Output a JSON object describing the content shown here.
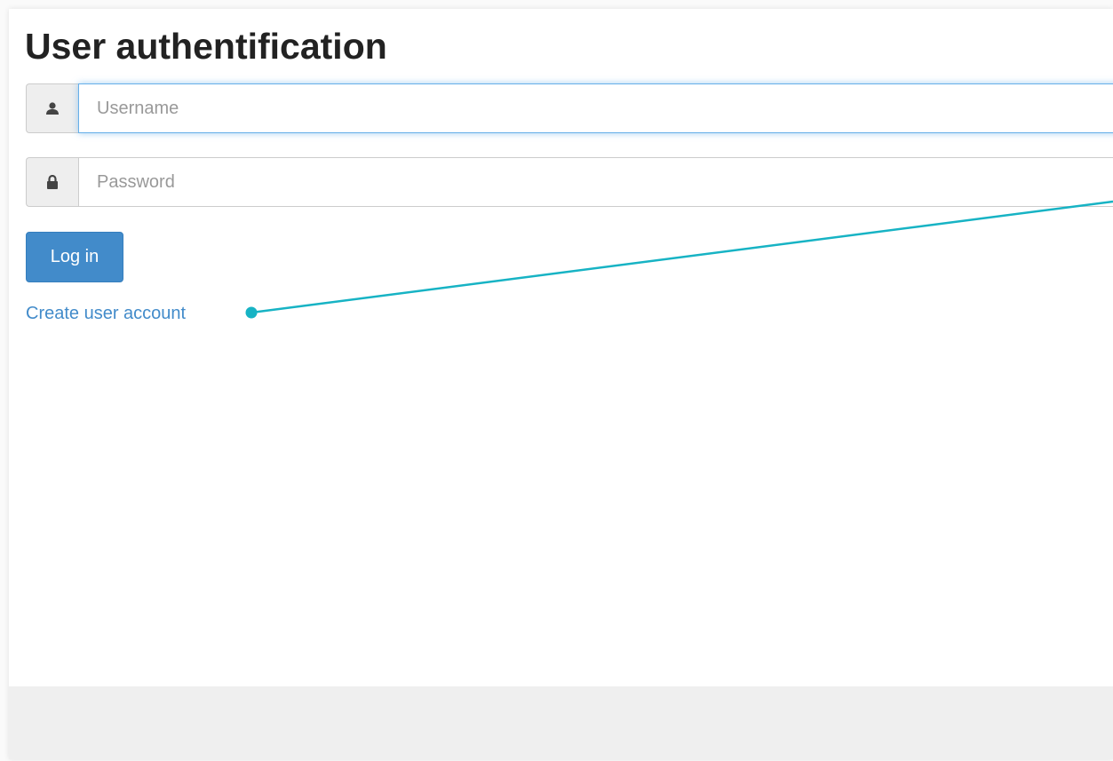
{
  "page": {
    "title": "User authentification"
  },
  "form": {
    "username": {
      "value": "",
      "placeholder": "Username",
      "icon": "user-icon"
    },
    "password": {
      "value": "",
      "placeholder": "Password",
      "icon": "lock-icon"
    },
    "login_label": "Log in",
    "create_account_label": "Create user account"
  },
  "colors": {
    "primary": "#428bca",
    "focus_border": "#66afe9",
    "callout": "#17b3c4",
    "footer": "#efefef"
  }
}
